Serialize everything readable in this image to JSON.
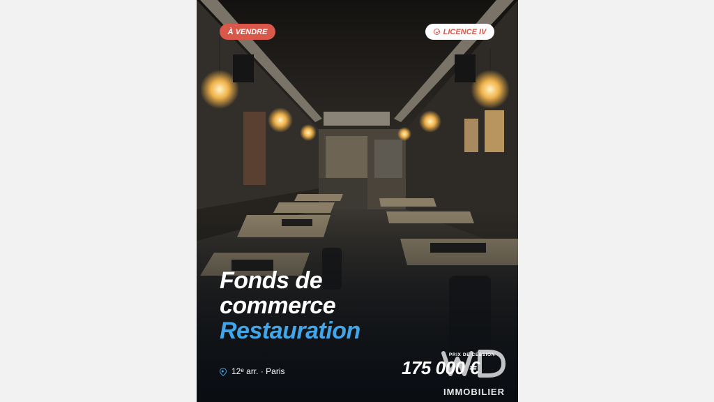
{
  "badges": {
    "sale": "À VENDRE",
    "licence": "LICENCE IV",
    "licence_icon": "check-circle-icon"
  },
  "title": {
    "line1": "Fonds de",
    "line2": "commerce",
    "line3": "Restauration"
  },
  "location": {
    "icon": "map-pin-icon",
    "text": "12ᵉ arr. · Paris"
  },
  "price": {
    "label": "PRIX DE CESSION",
    "value": "175 000 €"
  },
  "brand": {
    "name": "IMMOBILIER",
    "logo": "wd-logo"
  },
  "colors": {
    "accent_red": "#d9584a",
    "accent_blue": "#42a5e8",
    "background": "#f2f2f2"
  }
}
